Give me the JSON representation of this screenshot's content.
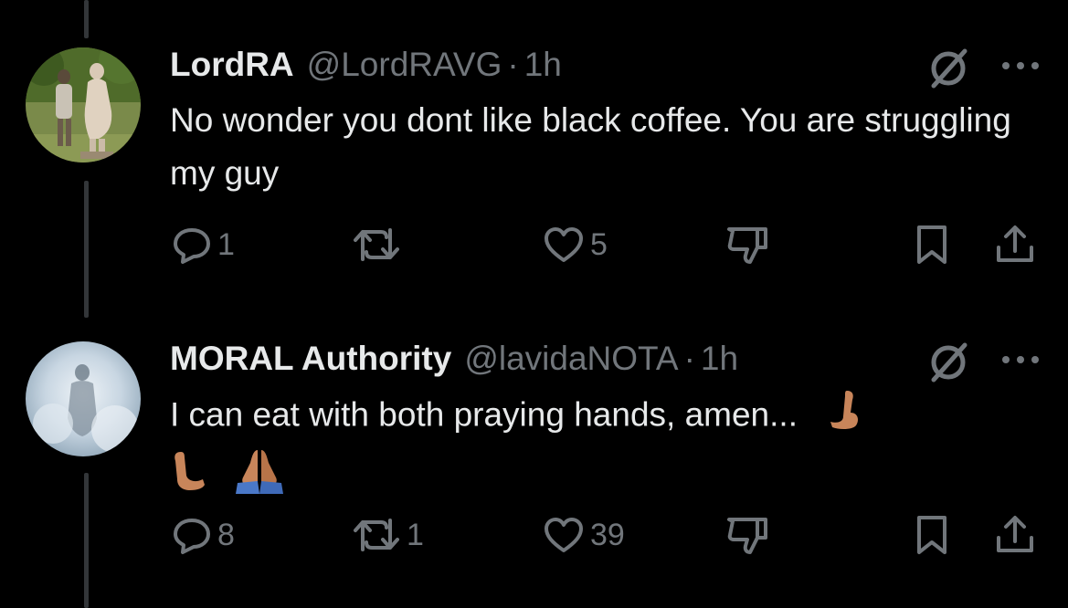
{
  "tweets": [
    {
      "name": "LordRA",
      "handle": "@LordRAVG",
      "separator": "·",
      "time": "1h",
      "text": "No wonder you dont like black coffee. You are struggling my guy",
      "reply_count": "1",
      "retweet_count": "",
      "like_count": "5",
      "avatar_icon": "photo-avatar-statues"
    },
    {
      "name": "MORAL Authority",
      "handle": "@lavidaNOTA",
      "separator": "·",
      "time": "1h",
      "text": "I can eat with both praying hands, amen...",
      "reply_count": "8",
      "retweet_count": "1",
      "like_count": "39",
      "avatar_icon": "photo-avatar-misty-figure"
    }
  ],
  "colors": {
    "background": "#000000",
    "text": "#e7e9ea",
    "muted": "#71767b",
    "thread_line": "#333639"
  }
}
